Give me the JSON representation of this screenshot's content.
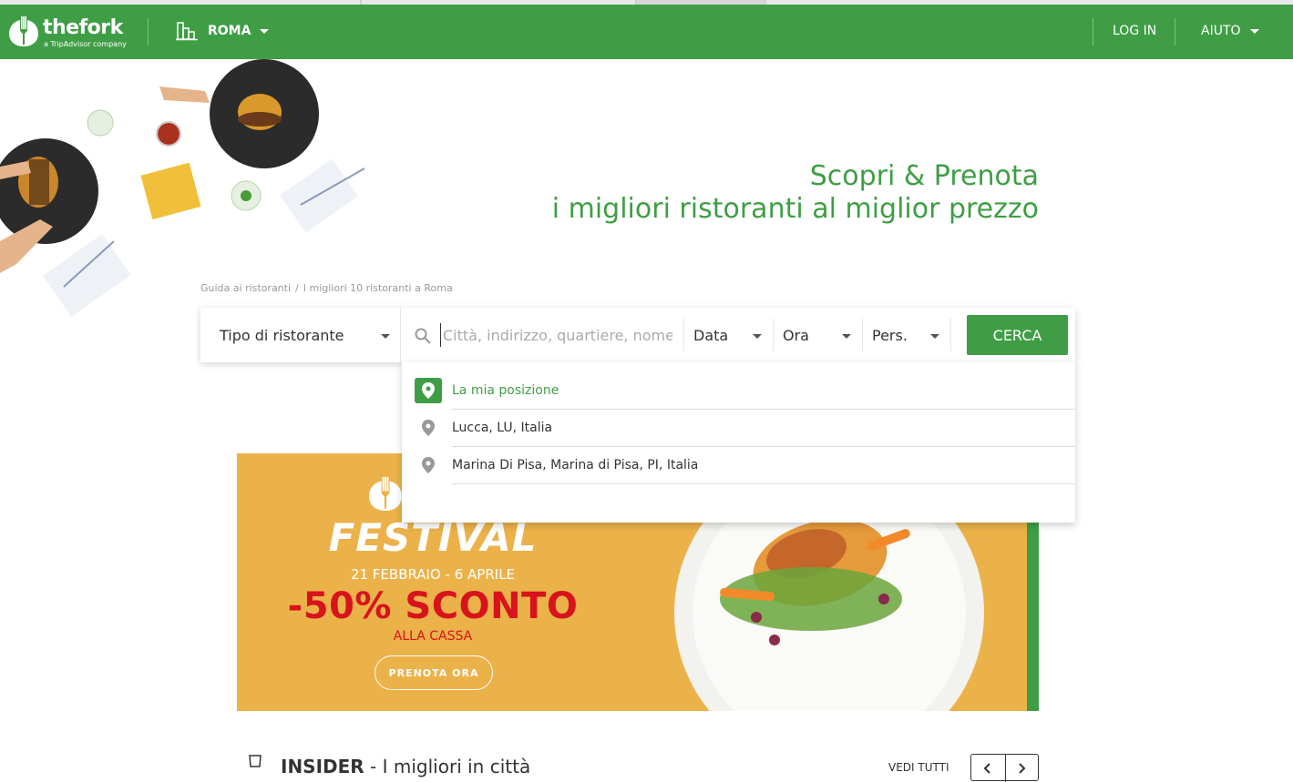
{
  "header": {
    "logo_name": "thefork",
    "logo_sub": "a TripAdvisor company",
    "city": "ROMA",
    "login": "LOG IN",
    "help": "AIUTO",
    "brand_color": "#3f9e45"
  },
  "hero": {
    "tagline_line1": "Scopri & Prenota",
    "tagline_line2": "i migliori ristoranti al miglior prezzo"
  },
  "breadcrumb": [
    "Guida ai ristoranti",
    "I migliori 10 ristoranti a Roma"
  ],
  "search": {
    "type_label": "Tipo di ristorante",
    "placeholder": "Città, indirizzo, quartiere, nome del ristorante",
    "date_label": "Data",
    "time_label": "Ora",
    "people_label": "Pers.",
    "submit_label": "CERCA"
  },
  "suggestions": [
    {
      "label": "La mia posizione",
      "icon": "location-pin-icon",
      "highlight": true
    },
    {
      "label": "Lucca, LU, Italia",
      "icon": "map-pin-icon",
      "highlight": false
    },
    {
      "label": "Marina Di Pisa, Marina di Pisa, PI, Italia",
      "icon": "map-pin-icon",
      "highlight": false
    }
  ],
  "promo": {
    "title": "FESTIVAL",
    "dates": "21 FEBBRAIO - 6 APRILE",
    "discount": "-50% SCONTO",
    "subtitle": "ALLA CASSA",
    "cta": "PRENOTA ORA",
    "bg_color": "#ebb24a",
    "accent_color": "#d7131c"
  },
  "insider": {
    "title_bold": "INSIDER",
    "title_rest": " - I migliori in città",
    "see_all": "VEDI TUTTI"
  }
}
